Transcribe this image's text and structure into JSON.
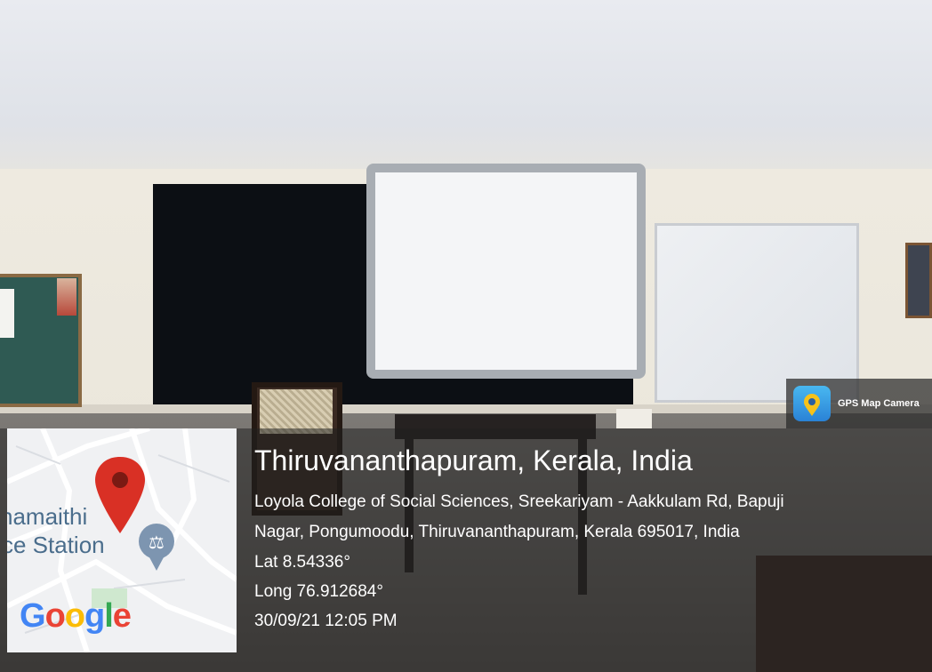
{
  "app_badge": {
    "name": "GPS Map Camera",
    "icon": "gps-map-camera-icon"
  },
  "map": {
    "labels": [
      "namaithi",
      "ce Station"
    ],
    "logo": "Google",
    "pin_color": "#d93025"
  },
  "location": {
    "title": "Thiruvananthapuram, Kerala, India",
    "address_line_1": "Loyola College of Social Sciences, Sreekariyam - Aakkulam Rd, Bapuji",
    "address_line_2": "Nagar, Pongumoodu, Thiruvananthapuram, Kerala 695017, India",
    "latitude": "Lat 8.54336°",
    "longitude": "Long 76.912684°",
    "datetime": "30/09/21 12:05 PM"
  }
}
